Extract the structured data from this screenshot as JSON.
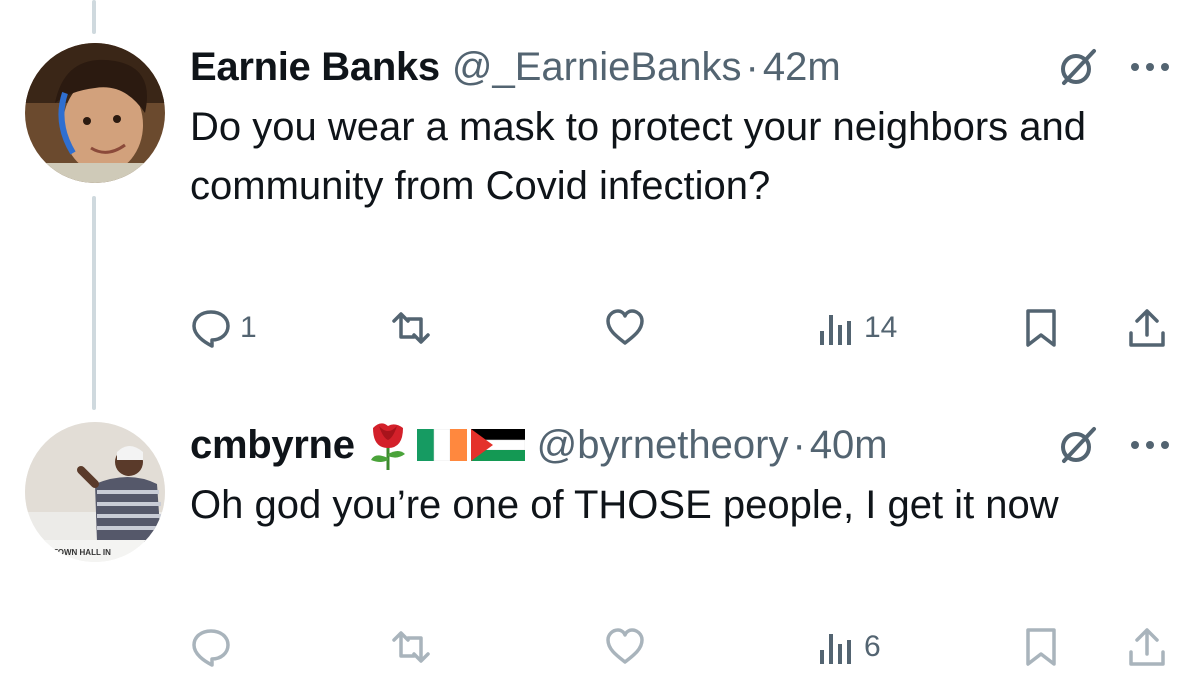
{
  "tweets": [
    {
      "display_name": "Earnie Banks",
      "handle": "@_EarnieBanks",
      "separator": "·",
      "time": "42m",
      "text": "Do you wear a mask to protect your neighbors and community from Covid infection?",
      "replies": "1",
      "retweets": "",
      "likes": "",
      "views": "14",
      "avatar_icon": "user-avatar-photo"
    },
    {
      "display_name": "cmbyrne",
      "name_emojis": [
        "rose",
        "ireland-flag",
        "palestine-flag"
      ],
      "handle": "@byrnetheory",
      "separator": "·",
      "time": "40m",
      "text": "Oh god you’re one of THOSE people, I get it now",
      "replies": "",
      "retweets": "",
      "likes": "",
      "views": "6",
      "avatar_icon": "user-avatar-photo",
      "avatar_caption": "TOWN HALL IN"
    }
  ],
  "colors": {
    "text": "#0f1419",
    "secondary": "#536471",
    "thread_line": "#cfd9de",
    "faded_icon": "#a9b4bc"
  }
}
